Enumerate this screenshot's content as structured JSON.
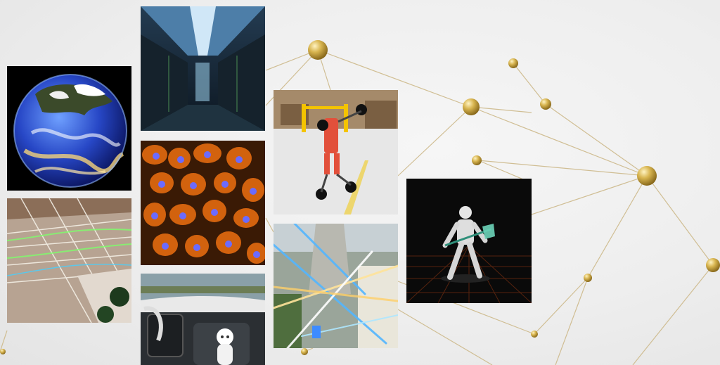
{
  "scene": {
    "theme": "connected network of AI application images",
    "accent_color": "#c9a646",
    "line_color": "#cdb98a",
    "background_color": "#eeeeee"
  },
  "tiles": [
    {
      "id": "earth",
      "subject": "earth-globe-climate-simulation"
    },
    {
      "id": "datacenter",
      "subject": "data-center-corridor"
    },
    {
      "id": "cells",
      "subject": "fluorescent-cell-microscopy"
    },
    {
      "id": "street",
      "subject": "autonomous-vehicle-sensor-paths"
    },
    {
      "id": "cockpit",
      "subject": "car-interior-avatar-assistant"
    },
    {
      "id": "robot",
      "subject": "wheeled-warehouse-robot"
    },
    {
      "id": "laser",
      "subject": "lidar-beams-city-simulation"
    },
    {
      "id": "humanoid",
      "subject": "humanoid-robot-grid-floor"
    }
  ]
}
